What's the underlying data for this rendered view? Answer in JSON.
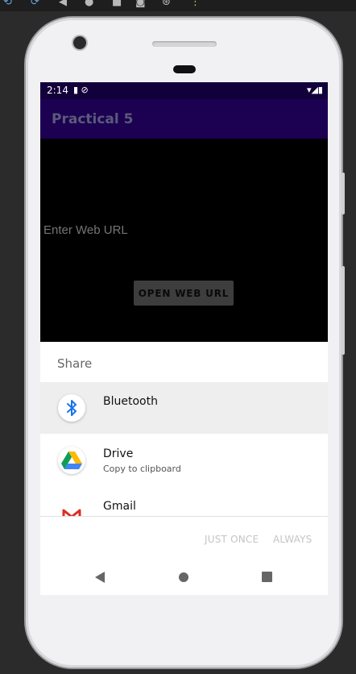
{
  "emulator": {
    "tool_icons": [
      "rotate-left-icon",
      "rotate-right-icon",
      "back-icon",
      "home-icon",
      "overview-icon",
      "screenshot-icon",
      "zoom-icon",
      "more-icon"
    ]
  },
  "status_bar": {
    "time": "2:14"
  },
  "app": {
    "title": "Practical 5"
  },
  "content": {
    "url_placeholder": "Enter Web URL",
    "open_button": "OPEN WEB URL"
  },
  "share_sheet": {
    "title": "Share",
    "items": [
      {
        "label": "Bluetooth",
        "sublabel": "",
        "icon": "bluetooth-icon",
        "selected": true
      },
      {
        "label": "Drive",
        "sublabel": "Copy to clipboard",
        "icon": "google-drive-icon",
        "selected": false
      },
      {
        "label": "Gmail",
        "sublabel": "",
        "icon": "gmail-icon",
        "selected": false
      }
    ],
    "just_once": "JUST ONCE",
    "always": "ALWAYS"
  },
  "colors": {
    "status_bar": "#12003a",
    "app_bar": "#1c0052",
    "content_bg": "#000000",
    "bluetooth": "#1a73e8"
  }
}
